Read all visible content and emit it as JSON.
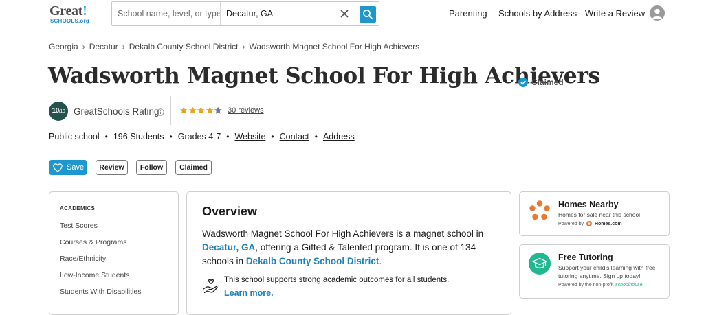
{
  "header": {
    "logo_main": "Great",
    "logo_bang": "!",
    "logo_sub": "SCHOOLS.org",
    "search_placeholder": "School name, level, or type",
    "location_value": "Decatur, GA",
    "nav": [
      "Parenting",
      "Schools by Address",
      "Write a Review"
    ]
  },
  "breadcrumb": [
    "Georgia",
    "Decatur",
    "Dekalb County School District",
    "Wadsworth Magnet School For High Achievers"
  ],
  "breadcrumb_separator": "›",
  "school": {
    "name": "Wadsworth Magnet School For High Achievers",
    "claimed_label": "Claimed",
    "rating_value": "10",
    "rating_scale": "/10",
    "rating_label": "GreatSchools Rating",
    "stars": 4,
    "stars_max": 5,
    "reviews_link": "30 reviews"
  },
  "meta": {
    "type": "Public school",
    "students": "196 Students",
    "grades": "Grades 4-7",
    "links": [
      "Website",
      "Contact",
      "Address"
    ],
    "separator": "•"
  },
  "actions": {
    "save": "Save",
    "review": "Review",
    "follow": "Follow",
    "claimed": "Claimed"
  },
  "sidebar": {
    "heading": "ACADEMICS",
    "items": [
      "Test Scores",
      "Courses & Programs",
      "Race/Ethnicity",
      "Low-Income Students",
      "Students With Disabilities"
    ]
  },
  "overview": {
    "title": "Overview",
    "text_1": "Wadsworth Magnet School For High Achievers is a magnet school in",
    "link_1": "Decatur, GA",
    "text_2": ", offering a Gifted & Talented program. It is one of 134 schools in",
    "link_2": "Dekalb County School District",
    "text_3": ".",
    "support": "This school supports strong academic outcomes for all students.",
    "learn_more": "Learn more."
  },
  "cards": {
    "homes": {
      "title": "Homes Nearby",
      "subtitle": "Homes for sale near this school",
      "powered": "Powered by",
      "partner": "Homes.com"
    },
    "tutoring": {
      "title": "Free Tutoring",
      "subtitle": "Support your child's learning with free tutoring anytime. Sign up today!",
      "powered": "Powered by the non-profit",
      "partner": "schoolhouse"
    }
  },
  "colors": {
    "accent_blue": "#1d98cf",
    "link_blue": "#1d82b8",
    "rating_green": "#24524d",
    "star_gold": "#e8a317",
    "homes_orange": "#e8792f",
    "tutor_teal": "#1fb891"
  }
}
